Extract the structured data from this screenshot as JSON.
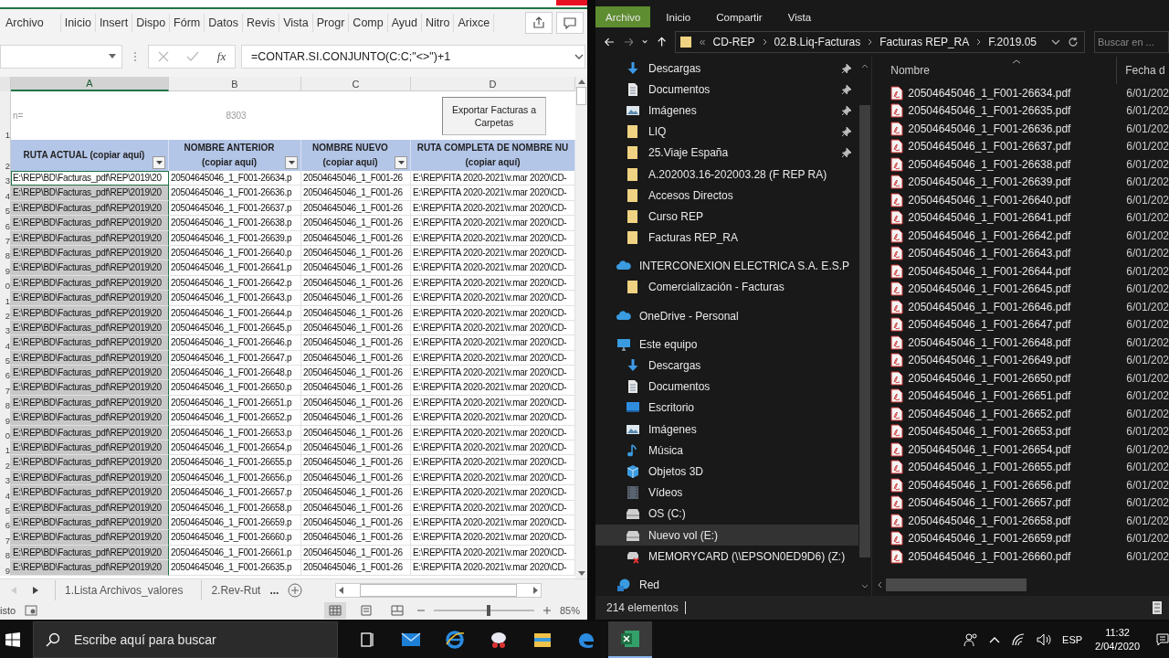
{
  "excel": {
    "ribbon_tabs": [
      "Archivo",
      "Inicio",
      "Insert",
      "Dispo",
      "Fórm",
      "Datos",
      "Revis",
      "Vista",
      "Progr",
      "Comp",
      "Ayud",
      "Nitro",
      "Arixce"
    ],
    "formula_bar": {
      "function_label": "fx",
      "formula": "=CONTAR.SI.CONJUNTO(C:C;\"<>\")+1"
    },
    "columns": [
      {
        "letter": "A",
        "selected": true
      },
      {
        "letter": "B",
        "selected": false
      },
      {
        "letter": "C",
        "selected": false
      },
      {
        "letter": "D",
        "selected": false
      }
    ],
    "summary_row": {
      "number": "1",
      "label": "n=",
      "count": "8303",
      "button": "Exportar Facturas a Carpetas"
    },
    "header_row": {
      "number": "2",
      "headers": [
        {
          "text": "RUTA ACTUAL (copiar aquí)",
          "filter": true
        },
        {
          "text": "NOMBRE ANTERIOR (copiar aquí)",
          "filter": true
        },
        {
          "text": "NOMBRE NUEVO (copiar aquí)",
          "filter": true
        },
        {
          "text": "RUTA COMPLETA DE NOMBRE NU (copiar aquí)",
          "filter": false
        }
      ]
    },
    "rows": [
      {
        "number": "3",
        "active": true,
        "cells": [
          "E:\\REP\\BD\\Facturas_pdf\\REP\\2019\\20",
          "20504645046_1_F001-26634.p",
          "20504645046_1_F001-26",
          "E:\\REP\\FITA 2020-2021\\v.mar 2020\\CD-"
        ]
      },
      {
        "number": "4",
        "active": false,
        "cells": [
          "E:\\REP\\BD\\Facturas_pdf\\REP\\2019\\20",
          "20504645046_1_F001-26636.p",
          "20504645046_1_F001-26",
          "E:\\REP\\FITA 2020-2021\\v.mar 2020\\CD-"
        ]
      },
      {
        "number": "5",
        "active": false,
        "cells": [
          "E:\\REP\\BD\\Facturas_pdf\\REP\\2019\\20",
          "20504645046_1_F001-26637.p",
          "20504645046_1_F001-26",
          "E:\\REP\\FITA 2020-2021\\v.mar 2020\\CD-"
        ]
      },
      {
        "number": "6",
        "active": false,
        "cells": [
          "E:\\REP\\BD\\Facturas_pdf\\REP\\2019\\20",
          "20504645046_1_F001-26638.p",
          "20504645046_1_F001-26",
          "E:\\REP\\FITA 2020-2021\\v.mar 2020\\CD-"
        ]
      },
      {
        "number": "7",
        "active": false,
        "cells": [
          "E:\\REP\\BD\\Facturas_pdf\\REP\\2019\\20",
          "20504645046_1_F001-26639.p",
          "20504645046_1_F001-26",
          "E:\\REP\\FITA 2020-2021\\v.mar 2020\\CD-"
        ]
      },
      {
        "number": "8",
        "active": false,
        "cells": [
          "E:\\REP\\BD\\Facturas_pdf\\REP\\2019\\20",
          "20504645046_1_F001-26640.p",
          "20504645046_1_F001-26",
          "E:\\REP\\FITA 2020-2021\\v.mar 2020\\CD-"
        ]
      },
      {
        "number": "9",
        "active": false,
        "cells": [
          "E:\\REP\\BD\\Facturas_pdf\\REP\\2019\\20",
          "20504645046_1_F001-26641.p",
          "20504645046_1_F001-26",
          "E:\\REP\\FITA 2020-2021\\v.mar 2020\\CD-"
        ]
      },
      {
        "number": "0",
        "active": false,
        "cells": [
          "E:\\REP\\BD\\Facturas_pdf\\REP\\2019\\20",
          "20504645046_1_F001-26642.p",
          "20504645046_1_F001-26",
          "E:\\REP\\FITA 2020-2021\\v.mar 2020\\CD-"
        ]
      },
      {
        "number": "1",
        "active": false,
        "cells": [
          "E:\\REP\\BD\\Facturas_pdf\\REP\\2019\\20",
          "20504645046_1_F001-26643.p",
          "20504645046_1_F001-26",
          "E:\\REP\\FITA 2020-2021\\v.mar 2020\\CD-"
        ]
      },
      {
        "number": "2",
        "active": false,
        "cells": [
          "E:\\REP\\BD\\Facturas_pdf\\REP\\2019\\20",
          "20504645046_1_F001-26644.p",
          "20504645046_1_F001-26",
          "E:\\REP\\FITA 2020-2021\\v.mar 2020\\CD-"
        ]
      },
      {
        "number": "3",
        "active": false,
        "cells": [
          "E:\\REP\\BD\\Facturas_pdf\\REP\\2019\\20",
          "20504645046_1_F001-26645.p",
          "20504645046_1_F001-26",
          "E:\\REP\\FITA 2020-2021\\v.mar 2020\\CD-"
        ]
      },
      {
        "number": "4",
        "active": false,
        "cells": [
          "E:\\REP\\BD\\Facturas_pdf\\REP\\2019\\20",
          "20504645046_1_F001-26646.p",
          "20504645046_1_F001-26",
          "E:\\REP\\FITA 2020-2021\\v.mar 2020\\CD-"
        ]
      },
      {
        "number": "5",
        "active": false,
        "cells": [
          "E:\\REP\\BD\\Facturas_pdf\\REP\\2019\\20",
          "20504645046_1_F001-26647.p",
          "20504645046_1_F001-26",
          "E:\\REP\\FITA 2020-2021\\v.mar 2020\\CD-"
        ]
      },
      {
        "number": "6",
        "active": false,
        "cells": [
          "E:\\REP\\BD\\Facturas_pdf\\REP\\2019\\20",
          "20504645046_1_F001-26648.p",
          "20504645046_1_F001-26",
          "E:\\REP\\FITA 2020-2021\\v.mar 2020\\CD-"
        ]
      },
      {
        "number": "7",
        "active": false,
        "cells": [
          "E:\\REP\\BD\\Facturas_pdf\\REP\\2019\\20",
          "20504645046_1_F001-26650.p",
          "20504645046_1_F001-26",
          "E:\\REP\\FITA 2020-2021\\v.mar 2020\\CD-"
        ]
      },
      {
        "number": "8",
        "active": false,
        "cells": [
          "E:\\REP\\BD\\Facturas_pdf\\REP\\2019\\20",
          "20504645046_1_F001-26651.p",
          "20504645046_1_F001-26",
          "E:\\REP\\FITA 2020-2021\\v.mar 2020\\CD-"
        ]
      },
      {
        "number": "9",
        "active": false,
        "cells": [
          "E:\\REP\\BD\\Facturas_pdf\\REP\\2019\\20",
          "20504645046_1_F001-26652.p",
          "20504645046_1_F001-26",
          "E:\\REP\\FITA 2020-2021\\v.mar 2020\\CD-"
        ]
      },
      {
        "number": "0",
        "active": false,
        "cells": [
          "E:\\REP\\BD\\Facturas_pdf\\REP\\2019\\20",
          "20504645046_1_F001-26653.p",
          "20504645046_1_F001-26",
          "E:\\REP\\FITA 2020-2021\\v.mar 2020\\CD-"
        ]
      },
      {
        "number": "1",
        "active": false,
        "cells": [
          "E:\\REP\\BD\\Facturas_pdf\\REP\\2019\\20",
          "20504645046_1_F001-26654.p",
          "20504645046_1_F001-26",
          "E:\\REP\\FITA 2020-2021\\v.mar 2020\\CD-"
        ]
      },
      {
        "number": "2",
        "active": false,
        "cells": [
          "E:\\REP\\BD\\Facturas_pdf\\REP\\2019\\20",
          "20504645046_1_F001-26655.p",
          "20504645046_1_F001-26",
          "E:\\REP\\FITA 2020-2021\\v.mar 2020\\CD-"
        ]
      },
      {
        "number": "3",
        "active": false,
        "cells": [
          "E:\\REP\\BD\\Facturas_pdf\\REP\\2019\\20",
          "20504645046_1_F001-26656.p",
          "20504645046_1_F001-26",
          "E:\\REP\\FITA 2020-2021\\v.mar 2020\\CD-"
        ]
      },
      {
        "number": "4",
        "active": false,
        "cells": [
          "E:\\REP\\BD\\Facturas_pdf\\REP\\2019\\20",
          "20504645046_1_F001-26657.p",
          "20504645046_1_F001-26",
          "E:\\REP\\FITA 2020-2021\\v.mar 2020\\CD-"
        ]
      },
      {
        "number": "5",
        "active": false,
        "cells": [
          "E:\\REP\\BD\\Facturas_pdf\\REP\\2019\\20",
          "20504645046_1_F001-26658.p",
          "20504645046_1_F001-26",
          "E:\\REP\\FITA 2020-2021\\v.mar 2020\\CD-"
        ]
      },
      {
        "number": "6",
        "active": false,
        "cells": [
          "E:\\REP\\BD\\Facturas_pdf\\REP\\2019\\20",
          "20504645046_1_F001-26659.p",
          "20504645046_1_F001-26",
          "E:\\REP\\FITA 2020-2021\\v.mar 2020\\CD-"
        ]
      },
      {
        "number": "7",
        "active": false,
        "cells": [
          "E:\\REP\\BD\\Facturas_pdf\\REP\\2019\\20",
          "20504645046_1_F001-26660.p",
          "20504645046_1_F001-26",
          "E:\\REP\\FITA 2020-2021\\v.mar 2020\\CD-"
        ]
      },
      {
        "number": "8",
        "active": false,
        "cells": [
          "E:\\REP\\BD\\Facturas_pdf\\REP\\2019\\20",
          "20504645046_1_F001-26661.p",
          "20504645046_1_F001-26",
          "E:\\REP\\FITA 2020-2021\\v.mar 2020\\CD-"
        ]
      },
      {
        "number": "9",
        "active": false,
        "cells": [
          "E:\\REP\\BD\\Facturas_pdf\\REP\\2019\\20",
          "20504645046_1_F001-26635.p",
          "20504645046_1_F001-26",
          "E:\\REP\\FITA 2020-2021\\v.mar 2020\\CD-"
        ]
      }
    ],
    "sheet_tabs": [
      {
        "label": "1.Lista Archivos_valores",
        "selected": false
      },
      {
        "label": "2.Rev-Rut",
        "selected": false
      }
    ],
    "sheet_overflow": "...",
    "status": "isto",
    "zoom": {
      "level": 0.55,
      "reading": "85%"
    }
  },
  "explorer": {
    "ribbon_tabs": [
      {
        "label": "Archivo",
        "selected": true
      },
      {
        "label": "Inicio",
        "selected": false
      },
      {
        "label": "Compartir",
        "selected": false
      },
      {
        "label": "Vista",
        "selected": false
      }
    ],
    "address": {
      "overflow": "«",
      "crumbs": [
        "CD-REP",
        "02.B.Liq-Facturas",
        "Facturas REP_RA",
        "F.2019.05"
      ]
    },
    "search": {
      "placeholder": "Buscar en ..."
    },
    "quick_access": [
      {
        "label": "Descargas",
        "kind": "download",
        "pinned": true,
        "selected": false
      },
      {
        "label": "Documentos",
        "kind": "doc",
        "pinned": true,
        "selected": false
      },
      {
        "label": "Imágenes",
        "kind": "image",
        "pinned": true,
        "selected": false
      },
      {
        "label": "LIQ",
        "kind": "folder",
        "pinned": true,
        "selected": false
      },
      {
        "label": "25.Viaje España",
        "kind": "folder",
        "pinned": true,
        "selected": false
      },
      {
        "label": "A.202003.16-202003.28 (F REP RA)",
        "kind": "folder",
        "pinned": false,
        "selected": false
      },
      {
        "label": "Accesos Directos",
        "kind": "folder",
        "pinned": false,
        "selected": false
      },
      {
        "label": "Curso REP",
        "kind": "folder",
        "pinned": false,
        "selected": false
      },
      {
        "label": "Facturas REP_RA",
        "kind": "folder",
        "pinned": false,
        "selected": false
      }
    ],
    "tree": [
      {
        "label": "INTERCONEXION ELECTRICA S.A. E.S.P",
        "kind": "cloud",
        "selected": false,
        "children": [
          {
            "label": "Comercialización - Facturas",
            "kind": "folder",
            "selected": false
          }
        ]
      },
      {
        "label": "OneDrive - Personal",
        "kind": "cloud",
        "selected": false
      },
      {
        "label": "Este equipo",
        "kind": "pc",
        "selected": false,
        "children": [
          {
            "label": "Descargas",
            "kind": "download",
            "selected": false
          },
          {
            "label": "Documentos",
            "kind": "doc",
            "selected": false
          },
          {
            "label": "Escritorio",
            "kind": "desktop",
            "selected": false
          },
          {
            "label": "Imágenes",
            "kind": "image",
            "selected": false
          },
          {
            "label": "Música",
            "kind": "music",
            "selected": false
          },
          {
            "label": "Objetos 3D",
            "kind": "cube",
            "selected": false
          },
          {
            "label": "Vídeos",
            "kind": "video",
            "selected": false
          },
          {
            "label": "OS (C:)",
            "kind": "drive",
            "selected": false
          },
          {
            "label": "Nuevo vol (E:)",
            "kind": "drive",
            "selected": true
          },
          {
            "label": "MEMORYCARD (\\\\EPSON0ED9D6) (Z:)",
            "kind": "netdrive",
            "selected": false
          }
        ]
      },
      {
        "label": "Red",
        "kind": "network",
        "selected": false
      }
    ],
    "columns": [
      "Nombre",
      "Fecha d"
    ],
    "files": [
      {
        "name": "20504645046_1_F001-26634.pdf",
        "date": "6/01/202"
      },
      {
        "name": "20504645046_1_F001-26635.pdf",
        "date": "6/01/202"
      },
      {
        "name": "20504645046_1_F001-26636.pdf",
        "date": "6/01/202"
      },
      {
        "name": "20504645046_1_F001-26637.pdf",
        "date": "6/01/202"
      },
      {
        "name": "20504645046_1_F001-26638.pdf",
        "date": "6/01/202"
      },
      {
        "name": "20504645046_1_F001-26639.pdf",
        "date": "6/01/202"
      },
      {
        "name": "20504645046_1_F001-26640.pdf",
        "date": "6/01/202"
      },
      {
        "name": "20504645046_1_F001-26641.pdf",
        "date": "6/01/202"
      },
      {
        "name": "20504645046_1_F001-26642.pdf",
        "date": "6/01/202"
      },
      {
        "name": "20504645046_1_F001-26643.pdf",
        "date": "6/01/202"
      },
      {
        "name": "20504645046_1_F001-26644.pdf",
        "date": "6/01/202"
      },
      {
        "name": "20504645046_1_F001-26645.pdf",
        "date": "6/01/202"
      },
      {
        "name": "20504645046_1_F001-26646.pdf",
        "date": "6/01/202"
      },
      {
        "name": "20504645046_1_F001-26647.pdf",
        "date": "6/01/202"
      },
      {
        "name": "20504645046_1_F001-26648.pdf",
        "date": "6/01/202"
      },
      {
        "name": "20504645046_1_F001-26649.pdf",
        "date": "6/01/202"
      },
      {
        "name": "20504645046_1_F001-26650.pdf",
        "date": "6/01/202"
      },
      {
        "name": "20504645046_1_F001-26651.pdf",
        "date": "6/01/202"
      },
      {
        "name": "20504645046_1_F001-26652.pdf",
        "date": "6/01/202"
      },
      {
        "name": "20504645046_1_F001-26653.pdf",
        "date": "6/01/202"
      },
      {
        "name": "20504645046_1_F001-26654.pdf",
        "date": "6/01/202"
      },
      {
        "name": "20504645046_1_F001-26655.pdf",
        "date": "6/01/202"
      },
      {
        "name": "20504645046_1_F001-26656.pdf",
        "date": "6/01/202"
      },
      {
        "name": "20504645046_1_F001-26657.pdf",
        "date": "6/01/202"
      },
      {
        "name": "20504645046_1_F001-26658.pdf",
        "date": "6/01/202"
      },
      {
        "name": "20504645046_1_F001-26659.pdf",
        "date": "6/01/202"
      },
      {
        "name": "20504645046_1_F001-26660.pdf",
        "date": "6/01/202"
      }
    ],
    "status": "214 elementos"
  },
  "taskbar": {
    "search_placeholder": "Escribe aquí para buscar",
    "apps": [
      {
        "kind": "taskview",
        "active": false
      },
      {
        "kind": "mail",
        "active": false
      },
      {
        "kind": "ie",
        "active": false
      },
      {
        "kind": "snip",
        "active": false
      },
      {
        "kind": "explorer",
        "active": false
      },
      {
        "kind": "edge",
        "active": false
      },
      {
        "kind": "excel",
        "active": true
      }
    ],
    "language": "ESP",
    "time": "11:32",
    "date": "2/04/2020"
  }
}
